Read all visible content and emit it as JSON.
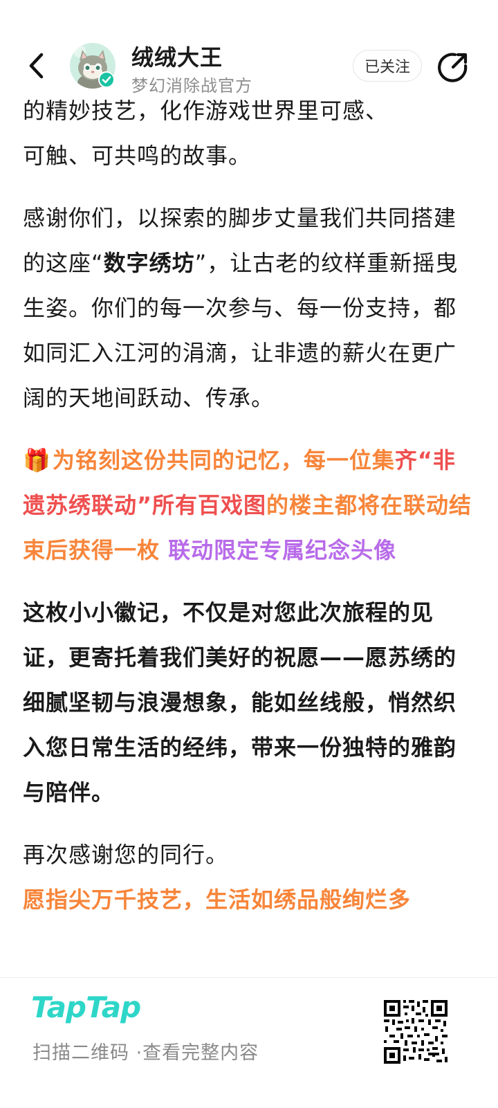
{
  "header": {
    "name": "绒绒大王",
    "subtitle": "梦幻消除战官方",
    "follow_label": "已关注"
  },
  "article": {
    "para_top_clipped": "的精妙技艺，化作游戏世界里可感、",
    "para1_line2": "可触、可共鸣的故事。",
    "para2_before": "感谢你们，以探索的脚步丈量我们共同搭建的这座“",
    "para2_bold": "数字绣坊",
    "para2_after": "”，让古老的纹样重新摇曳生姿。你们的每一次参与、每一份支持，都如同汇入江河的涓滴，让非遗的薪火在更广阔的天地间跃动、传承。",
    "promo_part1": "为铭刻这份共同的记忆，每一位集",
    "promo_part2": "齐“非遗苏绣联动”所有百戏图",
    "promo_part3": "的楼主都将在联动结束后获得一枚 ",
    "promo_part4": "联动限定专属纪念头像",
    "para4": "这枚小小徽记，不仅是对您此次旅程的见证，更寄托着我们美好的祝愿——愿苏绣的细腻坚韧与浪漫想象，能如丝线般，悄然织入您日常生活的经纬，带来一份独特的雅韵与陪伴。",
    "para5": "再次感谢您的同行。",
    "para6_cutoff": "愿指尖万千技艺，生活如绣品般绚烂多"
  },
  "footer": {
    "logo": "TapTap",
    "scan_hint": "扫描二维码 ·查看完整内容"
  },
  "colors": {
    "orange": "#f7853a",
    "red": "#ef4f4f",
    "purple": "#b86be9",
    "brand_teal": "#2ed6c8",
    "verified_green": "#19c3a2"
  },
  "icons": {
    "back": "chevron-left-icon",
    "share": "share-arrow-icon",
    "gift": "gift-icon",
    "verified": "verified-badge-icon",
    "qr": "qr-code-icon"
  }
}
